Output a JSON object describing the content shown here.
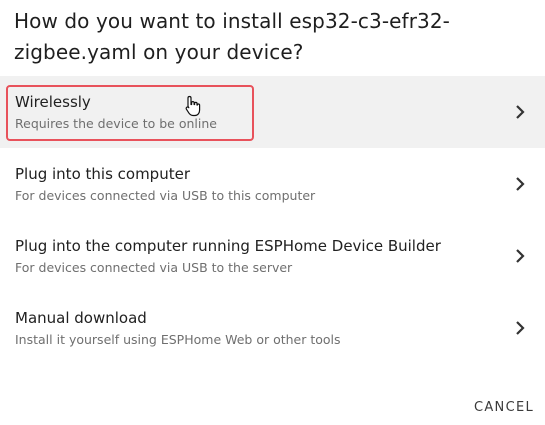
{
  "dialog": {
    "title": "How do you want to install esp32-c3-efr32-zigbee.yaml on your device?",
    "options": [
      {
        "label": "Wirelessly",
        "description": "Requires the device to be online",
        "icon": "chevron-right-icon"
      },
      {
        "label": "Plug into this computer",
        "description": "For devices connected via USB to this computer",
        "icon": "chevron-right-icon"
      },
      {
        "label": "Plug into the computer running ESPHome Device Builder",
        "description": "For devices connected via USB to the server",
        "icon": "chevron-right-icon"
      },
      {
        "label": "Manual download",
        "description": "Install it yourself using ESPHome Web or other tools",
        "icon": "chevron-right-icon"
      }
    ],
    "cancel_label": "CANCEL"
  },
  "colors": {
    "highlight": "#e8525b",
    "hover_background": "#f1f1f1"
  }
}
